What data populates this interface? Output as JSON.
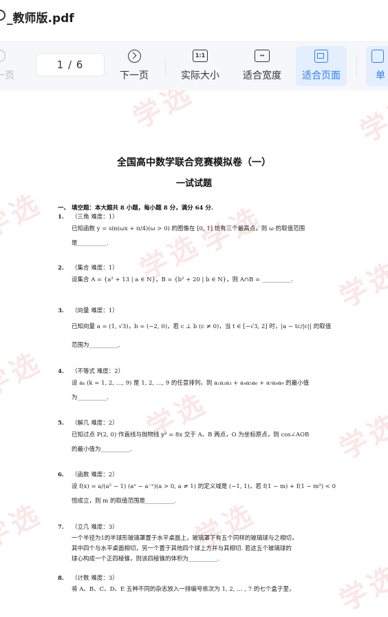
{
  "window": {
    "title": "_教师版.pdf"
  },
  "toolbar": {
    "prev_label": "上一页",
    "page_indicator": "1 / 6",
    "next_label": "下一页",
    "actual_size_label": "实际大小",
    "actual_size_icon_text": "1:1",
    "fit_width_label": "适合宽度",
    "fit_width_icon_text": "↔",
    "fit_page_label": "适合页面",
    "single_label": "单",
    "accent_color": "#2f7cf6"
  },
  "document": {
    "watermark": "学选",
    "title": "全国高中数学联合竞赛模拟卷（一）",
    "subtitle": "一试试题",
    "section": "一、 填空题：本大题共 8 小题，每小题 8 分，满分 64 分.",
    "questions": [
      {
        "num": "1.",
        "tag": "（三角 难度：1）",
        "lines": [
          "已知函数 y = sin(ωx + π/4)(ω > 0) 的图像在 [0, 1] 恰有三个最高点，则 ω 的取值范围",
          "是__________."
        ]
      },
      {
        "num": "2.",
        "tag": "（集合 难度：1）",
        "lines": [
          "设集合 A = {a² + 13 | a ∈ N}，B = {b² + 20 | b ∈ N}，则 A∩B = __________."
        ]
      },
      {
        "num": "3.",
        "tag": "（向量 难度：1）",
        "lines": [
          "已知向量 a = (1, √3)，b = (−2, 0)，若 c ⊥ b (c ≠ 0)，当 t ∈ [−√3, 2] 时，|a − tc/|c|| 的取值",
          "范围为__________."
        ]
      },
      {
        "num": "4.",
        "tag": "（不等式 难度：2）",
        "lines": [
          "设 aₖ (k = 1, 2, …, 9) 是 1, 2, …, 9 的任意排列，则 a₁a₂a₃ + a₄a₅a₆ + a₇a₈a₉ 的最小值",
          "为__________."
        ]
      },
      {
        "num": "5.",
        "tag": "（解几 难度：2）",
        "lines": [
          "已知过点 P(2, 0) 作直线与抛物线 y² = 8x 交于 A、B 两点，O 为坐标原点，则 cos∠AOB",
          "的最小值为__________."
        ]
      },
      {
        "num": "6.",
        "tag": "（函数 难度：2）",
        "lines": [
          "设 f(x) = a/(a² − 1) (aˣ − a⁻ˣ)(a > 0, a ≠ 1) 的定义域是 (−1, 1)，若 f(1 − m) + f(1 − m²) < 0",
          "恒成立，则 m 的取值范围是__________."
        ]
      },
      {
        "num": "7.",
        "tag": "（立几 难度：3）",
        "lines": [
          "一个半径为1的半球形玻璃罩置于水平桌面上，玻璃罩下有五个同样的玻璃球与之相切，",
          "其中四个与水平桌面相切，另一个置于其他四个球上方并与其相切. 若这五个玻璃球的",
          "球心构成一个正四棱锥，则该四棱锥的体积为__________."
        ]
      },
      {
        "num": "8.",
        "tag": "（计数 难度：3）",
        "lines": [
          "将 A、B、C、D、E 五种不同的杂志放入一排编号依次为 1, 2, … , 7 的七个盒子里，"
        ]
      }
    ]
  }
}
